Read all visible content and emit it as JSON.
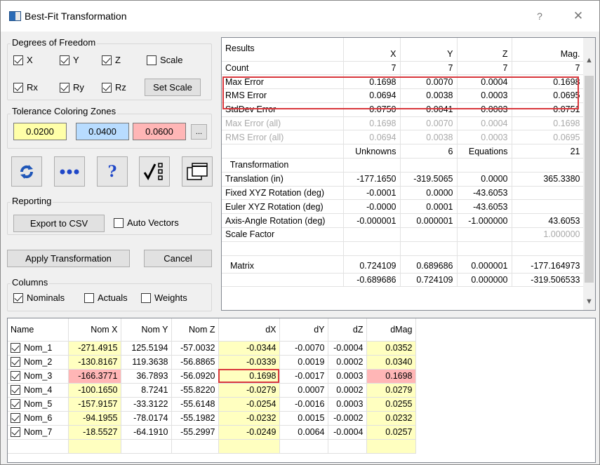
{
  "window": {
    "title": "Best-Fit Transformation",
    "help": "?",
    "close": "✕"
  },
  "dof": {
    "label": "Degrees of Freedom",
    "x": "X",
    "y": "Y",
    "z": "Z",
    "scale": "Scale",
    "rx": "Rx",
    "ry": "Ry",
    "rz": "Rz",
    "set_scale": "Set Scale",
    "checked": {
      "x": true,
      "y": true,
      "z": true,
      "scale": false,
      "rx": true,
      "ry": true,
      "rz": true
    }
  },
  "tolerance": {
    "label": "Tolerance Coloring Zones",
    "v1": "0.0200",
    "v2": "0.0400",
    "v3": "0.0600",
    "more": "...",
    "colors": [
      "#ffffa8",
      "#b8dcff",
      "#ffb6b6"
    ]
  },
  "toolbar": {
    "icons": [
      "refresh-icon",
      "more-dots-icon",
      "help-question-icon",
      "check-list-icon",
      "windows-icon"
    ]
  },
  "reporting": {
    "label": "Reporting",
    "export": "Export to CSV",
    "auto_vectors": "Auto Vectors",
    "auto_checked": false
  },
  "actions": {
    "apply": "Apply Transformation",
    "cancel": "Cancel"
  },
  "columns": {
    "label": "Columns",
    "nominals": "Nominals",
    "actuals": "Actuals",
    "weights": "Weights",
    "checked": {
      "nominals": true,
      "actuals": false,
      "weights": false
    }
  },
  "results": {
    "rows": [
      {
        "c": [
          "Results",
          "X",
          "Y",
          "Z",
          "Mag."
        ],
        "cls": "head"
      },
      {
        "c": [
          "Count",
          "7",
          "7",
          "7",
          "7"
        ]
      },
      {
        "c": [
          "Max Error",
          "0.1698",
          "0.0070",
          "0.0004",
          "0.1698"
        ]
      },
      {
        "c": [
          "RMS Error",
          "0.0694",
          "0.0038",
          "0.0003",
          "0.0695"
        ]
      },
      {
        "c": [
          "StdDev Error",
          "0.0750",
          "0.0041",
          "0.0003",
          "0.0751"
        ]
      },
      {
        "c": [
          "Max Error (all)",
          "0.1698",
          "0.0070",
          "0.0004",
          "0.1698"
        ],
        "cls": "dim"
      },
      {
        "c": [
          "RMS Error (all)",
          "0.0694",
          "0.0038",
          "0.0003",
          "0.0695"
        ],
        "cls": "dim"
      },
      {
        "c": [
          "",
          "Unknowns",
          "6",
          "Equations",
          "21"
        ]
      },
      {
        "c": [
          "  Transformation",
          "",
          "",
          "",
          ""
        ]
      },
      {
        "c": [
          "Translation (in)",
          "-177.1650",
          "-319.5065",
          "0.0000",
          "365.3380"
        ]
      },
      {
        "c": [
          "Fixed XYZ Rotation (deg)",
          "-0.0001",
          "0.0000",
          "-43.6053",
          ""
        ]
      },
      {
        "c": [
          "Euler XYZ Rotation (deg)",
          "-0.0000",
          "0.0001",
          "-43.6053",
          ""
        ]
      },
      {
        "c": [
          "Axis-Angle Rotation (deg)",
          "-0.000001",
          "0.000001",
          "-1.000000",
          "43.6053"
        ]
      },
      {
        "c": [
          "Scale Factor",
          "",
          "",
          "",
          "1.000000"
        ],
        "dimlast": true
      },
      {
        "c": [
          "",
          "",
          "",
          "",
          ""
        ]
      },
      {
        "c": [
          "  Matrix",
          "0.724109",
          "0.689686",
          "0.000001",
          "-177.164973"
        ],
        "cls": "tall"
      },
      {
        "c": [
          "",
          "-0.689686",
          "0.724109",
          "0.000000",
          "-319.506533"
        ]
      }
    ]
  },
  "nominals": {
    "headers": [
      "Name",
      "Nom X",
      "Nom Y",
      "Nom Z",
      "dX",
      "dY",
      "dZ",
      "dMag"
    ],
    "rows": [
      [
        "Nom_1",
        "-271.4915",
        "125.5194",
        "-57.0032",
        "-0.0344",
        "-0.0070",
        "-0.0004",
        "0.0352"
      ],
      [
        "Nom_2",
        "-130.8167",
        "119.3638",
        "-56.8865",
        "-0.0339",
        "0.0019",
        "0.0002",
        "0.0340"
      ],
      [
        "Nom_3",
        "-166.3771",
        "36.7893",
        "-56.0920",
        "0.1698",
        "-0.0017",
        "0.0003",
        "0.1698"
      ],
      [
        "Nom_4",
        "-100.1650",
        "8.7241",
        "-55.8220",
        "-0.0279",
        "0.0007",
        "0.0002",
        "0.0279"
      ],
      [
        "Nom_5",
        "-157.9157",
        "-33.3122",
        "-55.6148",
        "-0.0254",
        "-0.0016",
        "0.0003",
        "0.0255"
      ],
      [
        "Nom_6",
        "-94.1955",
        "-78.0174",
        "-55.1982",
        "-0.0232",
        "0.0015",
        "-0.0002",
        "0.0232"
      ],
      [
        "Nom_7",
        "-18.5527",
        "-64.1910",
        "-55.2997",
        "-0.0249",
        "0.0064",
        "-0.0004",
        "0.0257"
      ]
    ],
    "row_checked": [
      true,
      true,
      true,
      true,
      true,
      true,
      true
    ],
    "highlight_color": "#ffffc0",
    "alert_color": "#ffb6b6"
  }
}
